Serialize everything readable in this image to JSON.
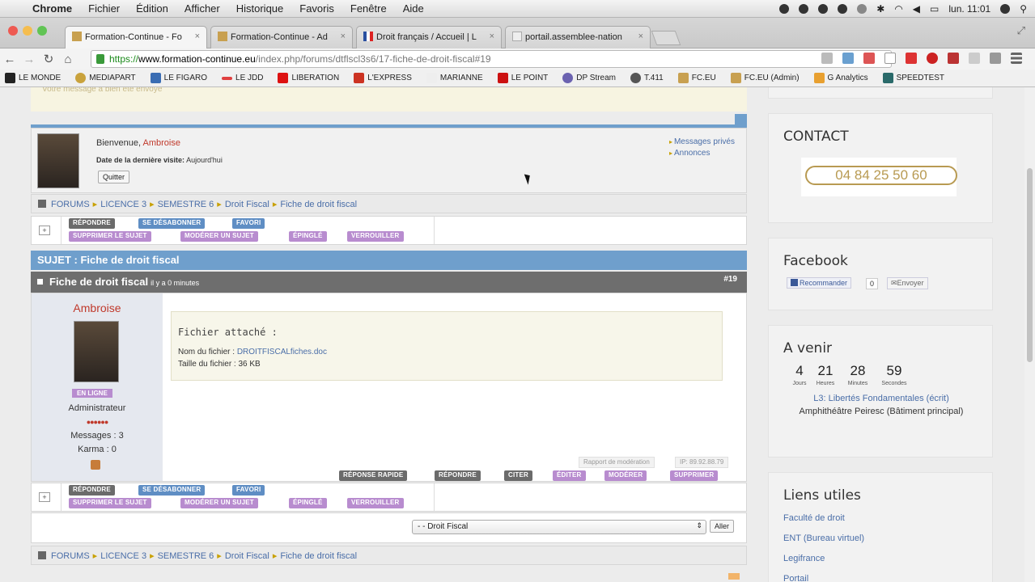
{
  "menubar": {
    "app": "Chrome",
    "items": [
      "Fichier",
      "Édition",
      "Afficher",
      "Historique",
      "Favoris",
      "Fenêtre",
      "Aide"
    ],
    "clock": "lun. 11:01"
  },
  "tabs": [
    {
      "label": "Formation-Continue - Fo",
      "active": true
    },
    {
      "label": "Formation-Continue - Ad",
      "active": false
    },
    {
      "label": "Droit français / Accueil | L",
      "active": false
    },
    {
      "label": "portail.assemblee-nation",
      "active": false
    }
  ],
  "url": {
    "scheme": "https://",
    "host": "www.formation-continue.eu",
    "path": "/index.php/forums/dtflscl3s6/17-fiche-de-droit-fiscal#19"
  },
  "bookmarks": [
    "LE MONDE",
    "MEDIAPART",
    "LE FIGARO",
    "LE JDD",
    "LIBERATION",
    "L'EXPRESS",
    "MARIANNE",
    "LE POINT",
    "DP Stream",
    "T.411",
    "FC.EU",
    "FC.EU (Admin)",
    "G Analytics",
    "SPEEDTEST"
  ],
  "notice": "Votre message a bien été envoyé",
  "welcome": {
    "hello": "Bienvenue,",
    "user": "Ambroise",
    "last_visit_label": "Date de la dernière visite:",
    "last_visit_value": "Aujourd'hui",
    "quit": "Quitter",
    "private_messages": "Messages privés",
    "announcements": "Annonces"
  },
  "breadcrumb": [
    "FORUMS",
    "LICENCE 3",
    "SEMESTRE 6",
    "Droit Fiscal",
    "Fiche de droit fiscal"
  ],
  "actions": {
    "row1": [
      "RÉPONDRE",
      "SE DÉSABONNER",
      "FAVORI"
    ],
    "row2": [
      "SUPPRIMER LE SUJET",
      "MODÉRER UN SUJET",
      "ÉPINGLÉ",
      "VERROUILLER"
    ]
  },
  "subject": "SUJET : Fiche de droit fiscal",
  "post": {
    "title": "Fiche de droit fiscal",
    "ago": "il y a 0 minutes",
    "number": "#19",
    "author": "Ambroise",
    "online": "EN LIGNE",
    "role": "Administrateur",
    "rank": "●●●●●●",
    "messages": "Messages : 3",
    "karma": "Karma : 0",
    "attach_title": "Fichier attaché :",
    "file_name_label": "Nom du fichier :",
    "file_name": "DROITFISCALfiches.doc",
    "file_size_label": "Taille du fichier :",
    "file_size": "36 KB",
    "report": "Rapport de modération",
    "ip": "IP: 89.92.88.79",
    "buttons": [
      "RÉPONSE RAPIDE",
      "RÉPONDRE",
      "CITER",
      "ÉDITER",
      "MODÉRER",
      "SUPPRIMER"
    ]
  },
  "jump": {
    "selected": "- - Droit Fiscal",
    "go": "Aller"
  },
  "sidebar": {
    "contact_title": "CONTACT",
    "phone": "04 84 25 50 60",
    "facebook_title": "Facebook",
    "fb_like": "Recommander",
    "fb_count": "0",
    "fb_send": "Envoyer",
    "upcoming_title": "A venir",
    "countdown": [
      {
        "v": "4",
        "u": "Jours"
      },
      {
        "v": "21",
        "u": "Heures"
      },
      {
        "v": "28",
        "u": "Minutes"
      },
      {
        "v": "59",
        "u": "Secondes"
      }
    ],
    "event_title": "L3: Libertés Fondamentales (écrit)",
    "event_place": "Amphithéâtre Peiresc (Bâtiment principal)",
    "links_title": "Liens utiles",
    "links": [
      "Faculté de droit",
      "ENT (Bureau virtuel)",
      "Legifrance",
      "Portail"
    ]
  }
}
